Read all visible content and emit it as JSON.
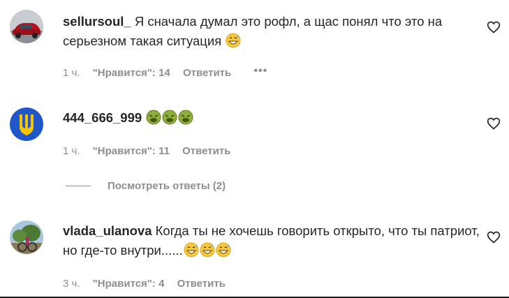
{
  "comments": [
    {
      "username": "sellursoul_",
      "text": " Я сначала думал это рофл, а щас понял что это на серьезном такая ситуация",
      "emojis": [
        "grinning-sweat-emoji"
      ],
      "time": "1 ч.",
      "likes": "\"Нравится\": 14",
      "reply": "Ответить",
      "more": "•••"
    },
    {
      "username": "444_666_999",
      "text": "",
      "emojis": [
        "nauseated-face-emoji",
        "nauseated-face-emoji",
        "nauseated-face-emoji"
      ],
      "time": "1 ч.",
      "likes": "\"Нравится\": 11",
      "reply": "Ответить"
    },
    {
      "username": "vlada_ulanova",
      "text": " Когда ты не хочешь говорить открыто, что ты патриот, но где-то внутри......",
      "emojis": [
        "grinning-sweat-emoji",
        "grinning-sweat-emoji",
        "grinning-sweat-emoji"
      ],
      "time": "3 ч.",
      "likes": "\"Нравится\": 4",
      "reply": "Ответить"
    }
  ],
  "view_replies": "Посмотреть ответы (2)",
  "colors": {
    "text": "#262626",
    "secondary": "#8e8e8e",
    "ukraine_blue": "#1f57c8",
    "ukraine_yellow": "#f5c400"
  }
}
